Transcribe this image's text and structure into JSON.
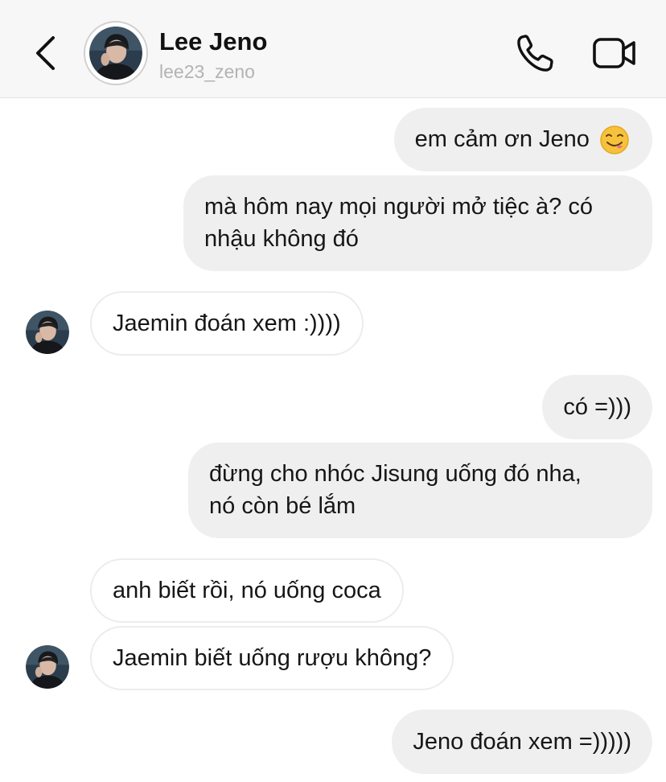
{
  "header": {
    "name": "Lee Jeno",
    "handle": "lee23_zeno"
  },
  "icons": {
    "back": "chevron-left-icon",
    "call": "phone-icon",
    "video": "video-camera-icon",
    "emoji": "face-savoring-food-emoji"
  },
  "colors": {
    "outgoing_bubble": "#efefef",
    "incoming_bubble_border": "#ececec",
    "header_bg": "#f7f7f7",
    "handle_text": "#b3b3b3"
  },
  "messages": [
    {
      "direction": "outgoing",
      "text": "em cảm ơn Jeno"
    },
    {
      "direction": "outgoing",
      "line1": "mà hôm nay mọi người mở tiệc à? có",
      "line2": "nhậu không đó"
    },
    {
      "direction": "incoming",
      "text": "Jaemin đoán xem :))))"
    },
    {
      "direction": "outgoing",
      "text": "có =)))"
    },
    {
      "direction": "outgoing",
      "line1": "đừng cho nhóc Jisung uống đó nha,",
      "line2": "nó còn bé lắm"
    },
    {
      "direction": "incoming",
      "text": "anh biết rồi, nó uống coca"
    },
    {
      "direction": "incoming",
      "text": "Jaemin biết uống rượu không?"
    },
    {
      "direction": "outgoing",
      "text": "Jeno đoán xem =)))))"
    }
  ]
}
